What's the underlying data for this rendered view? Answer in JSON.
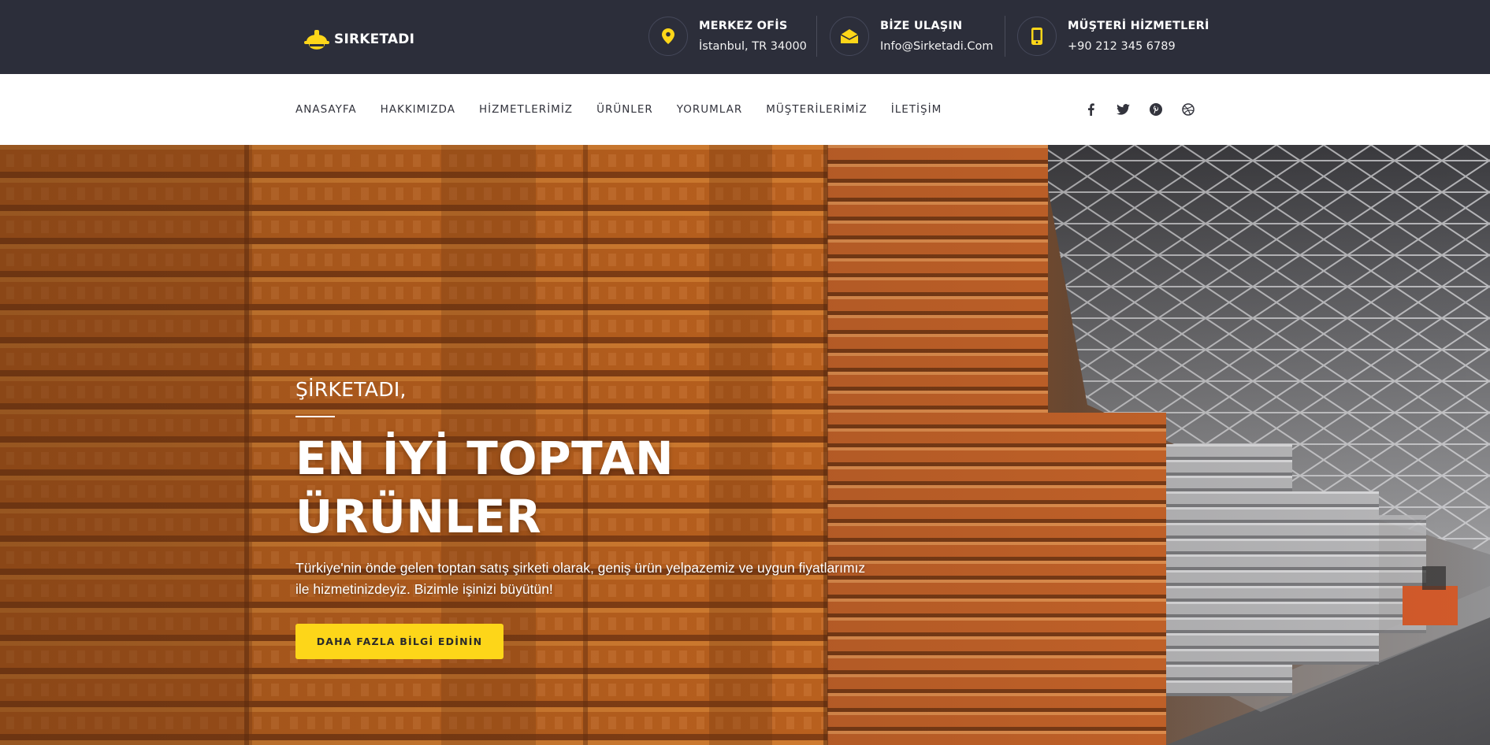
{
  "brand": {
    "name": "SIRKETADI",
    "accent_color": "#fdd619",
    "topbar_color": "#2c2e3a"
  },
  "contacts": [
    {
      "icon": "location-pin-icon",
      "title": "MERKEZ OFİS",
      "value": "İstanbul, TR 34000"
    },
    {
      "icon": "envelope-icon",
      "title": "BİZE ULAŞIN",
      "value": "Info@Sirketadi.Com"
    },
    {
      "icon": "mobile-phone-icon",
      "title": "MÜŞTERİ HİZMETLERİ",
      "value": "+90 212 345 6789"
    }
  ],
  "nav": {
    "items": [
      {
        "label": "ANASAYFA"
      },
      {
        "label": "HAKKIMIZDA"
      },
      {
        "label": "HİZMETLERİMİZ"
      },
      {
        "label": "ÜRÜNLER"
      },
      {
        "label": "YORUMLAR"
      },
      {
        "label": "MÜŞTERİLERİMİZ"
      },
      {
        "label": "İLETİŞİM"
      }
    ],
    "social": [
      "facebook-icon",
      "twitter-icon",
      "pinterest-icon",
      "dribbble-icon"
    ]
  },
  "hero": {
    "eyebrow": "ŞİRKETADI,",
    "headline_line1": "EN İYİ TOPTAN",
    "headline_line2": "ÜRÜNLER",
    "lead": "Türkiye'nin önde gelen toptan satış şirketi olarak, geniş ürün yelpazemiz ve uygun fiyatlarımız ile hizmetinizdeyiz. Bizimle işinizi büyütün!",
    "cta_label": "DAHA FAZLA BİLGİ EDİNİN"
  }
}
